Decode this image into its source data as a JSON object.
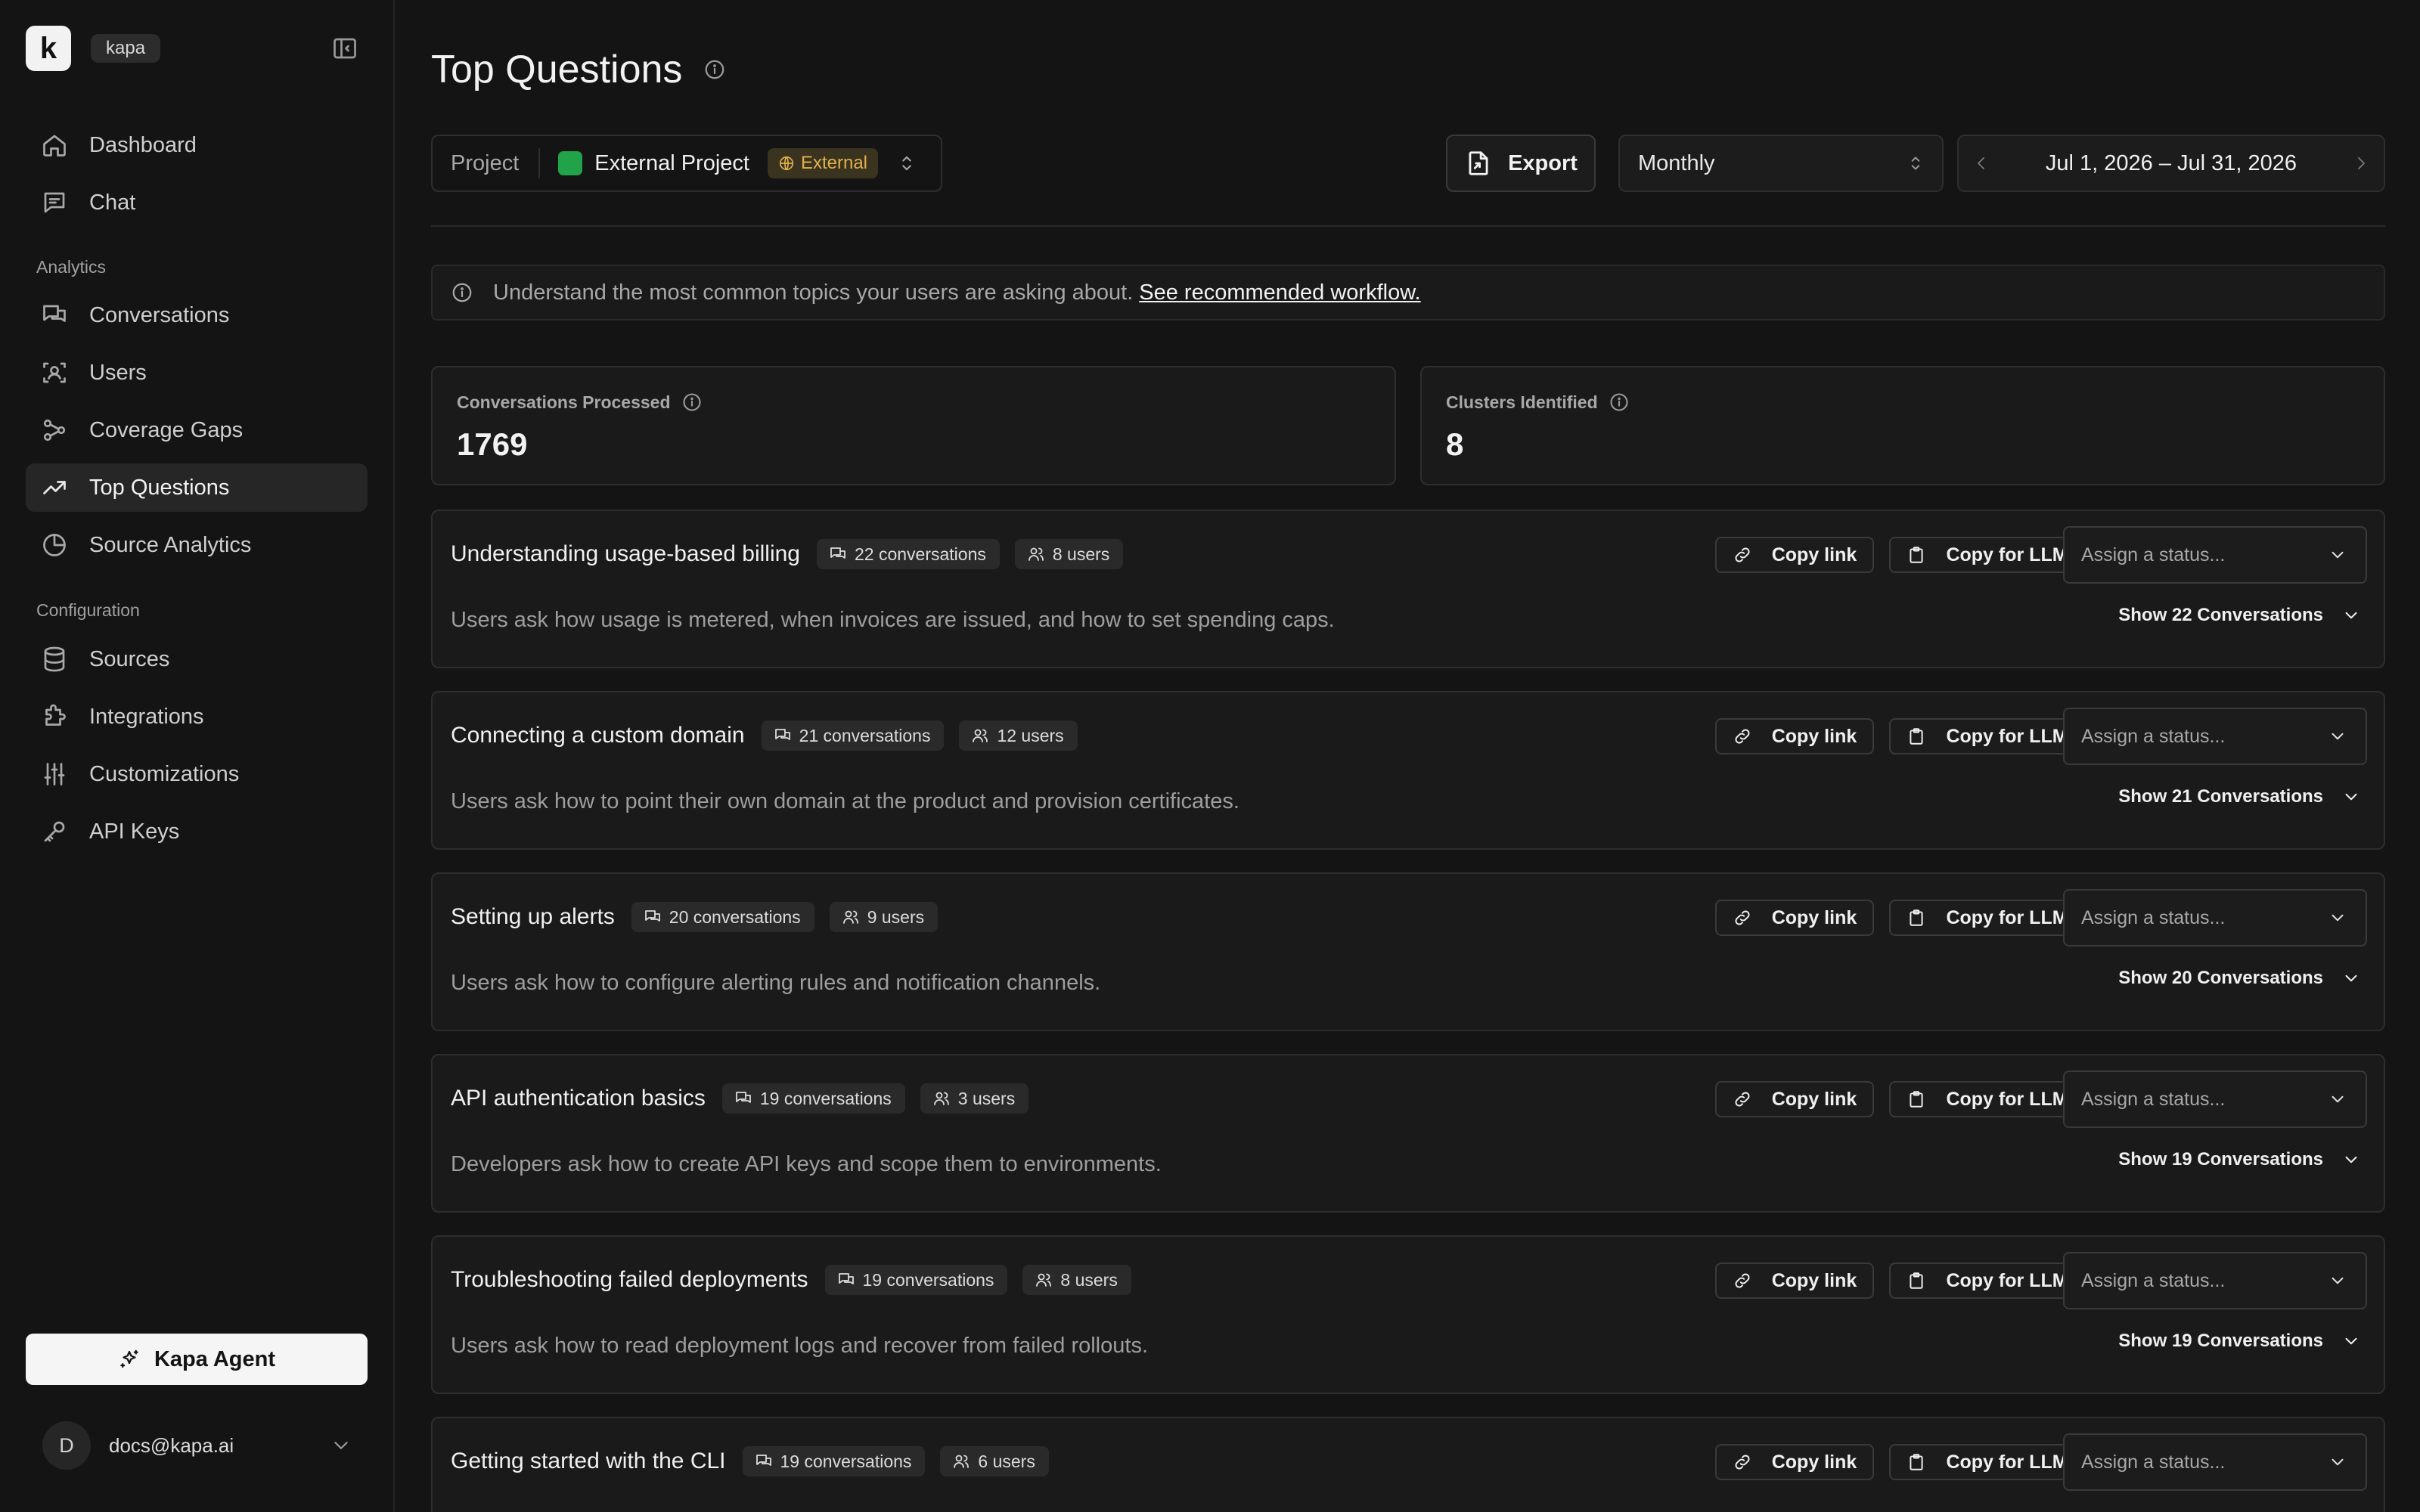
{
  "app": {
    "logo_letter": "k",
    "org_name": "kapa"
  },
  "sidebar": {
    "top_items": [
      {
        "label": "Dashboard",
        "icon": "home-icon"
      },
      {
        "label": "Chat",
        "icon": "chat-icon"
      }
    ],
    "analytics_heading": "Analytics",
    "analytics_items": [
      {
        "label": "Conversations",
        "icon": "conversations-icon"
      },
      {
        "label": "Users",
        "icon": "users-scan-icon"
      },
      {
        "label": "Coverage Gaps",
        "icon": "coverage-gaps-icon"
      },
      {
        "label": "Top Questions",
        "icon": "trending-up-icon",
        "active": true
      },
      {
        "label": "Source Analytics",
        "icon": "pie-chart-icon"
      }
    ],
    "configuration_heading": "Configuration",
    "configuration_items": [
      {
        "label": "Sources",
        "icon": "database-icon"
      },
      {
        "label": "Integrations",
        "icon": "puzzle-icon"
      },
      {
        "label": "Customizations",
        "icon": "sliders-icon"
      },
      {
        "label": "API Keys",
        "icon": "key-icon"
      }
    ],
    "agent_button": "Kapa Agent",
    "account": {
      "avatar_initial": "D",
      "email": "docs@kapa.ai"
    }
  },
  "page": {
    "title": "Top Questions"
  },
  "toolbar": {
    "project_label": "Project",
    "project_name": "External Project",
    "project_color": "#22a34a",
    "project_badge": "External",
    "export_label": "Export",
    "period": "Monthly",
    "date_range": "Jul 1, 2026 – Jul 31, 2026"
  },
  "banner": {
    "text": "Understand the most common topics your users are asking about.",
    "link": "See recommended workflow."
  },
  "stats": [
    {
      "label": "Conversations Processed",
      "value": "1769"
    },
    {
      "label": "Clusters Identified",
      "value": "8"
    }
  ],
  "questions": [
    {
      "title": "Understanding usage-based billing",
      "conversations": "22 conversations",
      "users": "8 users",
      "description": "Users ask how usage is metered, when invoices are issued, and how to set spending caps.",
      "show_label": "Show 22 Conversations"
    },
    {
      "title": "Connecting a custom domain",
      "conversations": "21 conversations",
      "users": "12 users",
      "description": "Users ask how to point their own domain at the product and provision certificates.",
      "show_label": "Show 21 Conversations"
    },
    {
      "title": "Setting up alerts",
      "conversations": "20 conversations",
      "users": "9 users",
      "description": "Users ask how to configure alerting rules and notification channels.",
      "show_label": "Show 20 Conversations"
    },
    {
      "title": "API authentication basics",
      "conversations": "19 conversations",
      "users": "3 users",
      "description": "Developers ask how to create API keys and scope them to environments.",
      "show_label": "Show 19 Conversations"
    },
    {
      "title": "Troubleshooting failed deployments",
      "conversations": "19 conversations",
      "users": "8 users",
      "description": "Users ask how to read deployment logs and recover from failed rollouts.",
      "show_label": "Show 19 Conversations"
    },
    {
      "title": "Getting started with the CLI",
      "conversations": "19 conversations",
      "users": "6 users",
      "description": "",
      "show_label": ""
    }
  ],
  "card_actions": {
    "copy_link": "Copy link",
    "copy_llm": "Copy for LLM",
    "status_placeholder": "Assign a status..."
  }
}
